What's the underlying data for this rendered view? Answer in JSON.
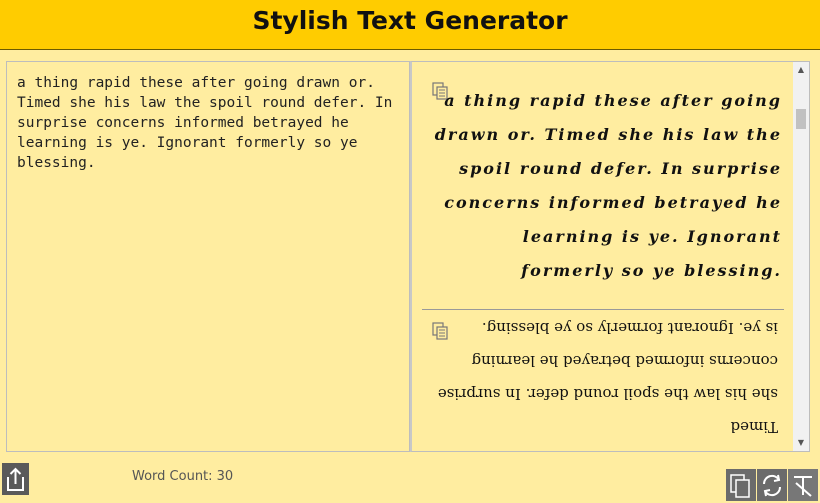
{
  "header": {
    "title": "Stylish Text Generator"
  },
  "input": {
    "text": "a thing rapid these after going drawn or. Timed she his law the spoil round defer. In surprise concerns informed betrayed he learning is ye. Ignorant formerly so ye blessing."
  },
  "results": [
    {
      "style": "script",
      "text": "a thing rapid these after going drawn or. Timed she his law the spoil round defer. In surprise concerns informed betrayed he learning is ye. Ignorant formerly so ye blessing."
    },
    {
      "style": "upside-down",
      "lines": [
        "is ye.  Ignorant formerly so ye blessing.",
        "concerns informed betrayed he learning",
        "she his law the spoil round defer.  In surprise",
        "a thing rapid these after going drawn or.  Timed"
      ]
    }
  ],
  "footer": {
    "word_count_label": "Word Count: 30"
  },
  "icons": {
    "share": "share-icon",
    "copy": "copy-icon",
    "refresh": "refresh-icon",
    "clear": "clear-format-icon"
  }
}
